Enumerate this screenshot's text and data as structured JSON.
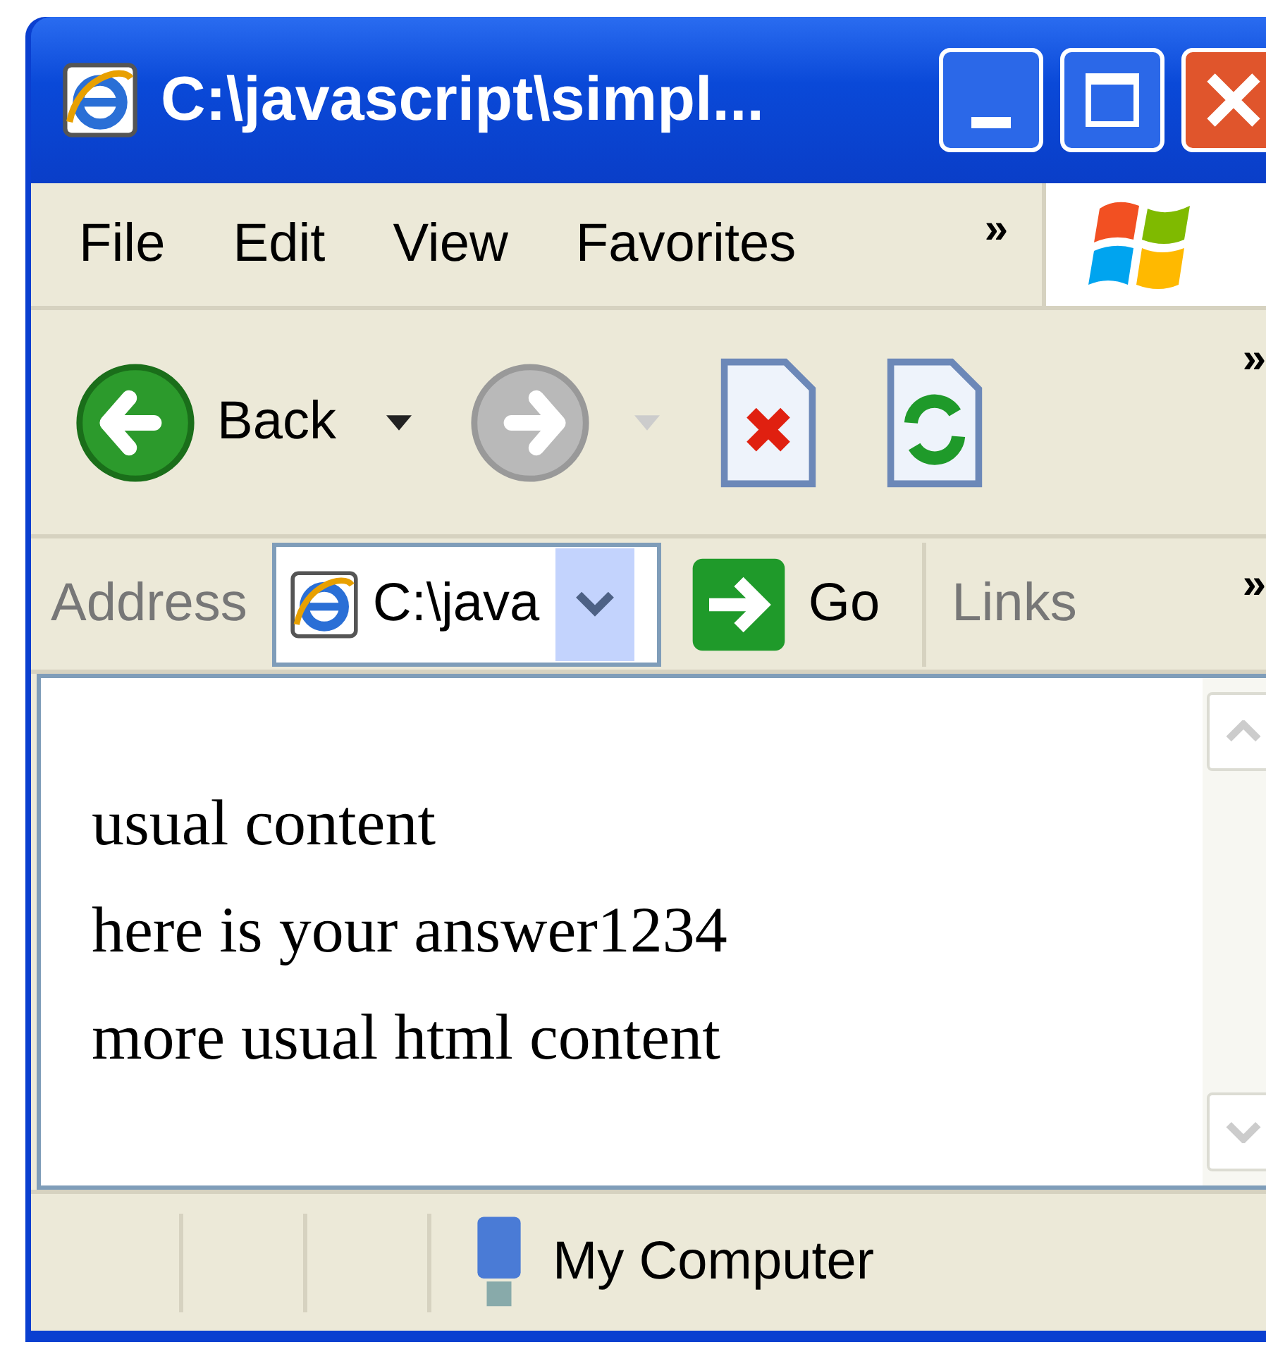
{
  "window": {
    "title": "C:\\javascript\\simpl..."
  },
  "menu": {
    "items": [
      {
        "label": "File"
      },
      {
        "label": "Edit"
      },
      {
        "label": "View"
      },
      {
        "label": "Favorites"
      }
    ],
    "overflow": "»"
  },
  "toolbar": {
    "back": {
      "label": "Back",
      "disabled": false
    },
    "forward": {
      "disabled": true
    },
    "overflow": "»"
  },
  "address": {
    "label": "Address",
    "value": "C:\\java",
    "go": "Go",
    "links": "Links",
    "overflow": "»"
  },
  "content": {
    "lines": [
      "usual content",
      "here is your answer1234",
      "more usual html content"
    ]
  },
  "status_bar": {
    "zone": "My Computer"
  }
}
